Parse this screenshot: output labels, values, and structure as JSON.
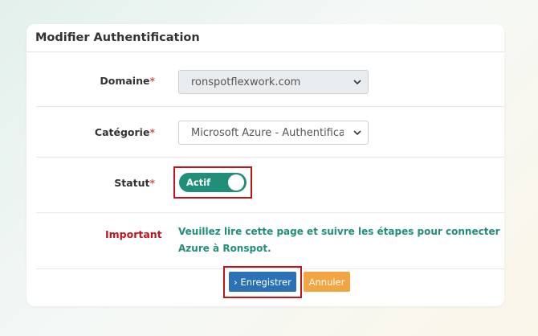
{
  "card": {
    "title": "Modifier Authentification"
  },
  "form": {
    "domain": {
      "label": "Domaine",
      "required_mark": "*",
      "value": "ronspotflexwork.com"
    },
    "category": {
      "label": "Catégorie",
      "required_mark": "*",
      "value": "Microsoft Azure - Authentificati"
    },
    "status": {
      "label": "Statut",
      "required_mark": "*",
      "toggle_label": "Actif",
      "on": true
    },
    "important": {
      "label": "Important",
      "message": "Veuillez lire cette page et suivre les étapes pour connecter Azure à Ronspot."
    }
  },
  "actions": {
    "save_label": "› Enregistrer",
    "cancel_label": "Annuler"
  },
  "colors": {
    "accent": "#1f8f7a",
    "primary_button": "#2a72b5",
    "cancel_button": "#f2a540",
    "highlight_box": "#c0141c",
    "important_text": "#c0141c"
  },
  "icons": {
    "select_chevron": "chevron-down-icon"
  }
}
